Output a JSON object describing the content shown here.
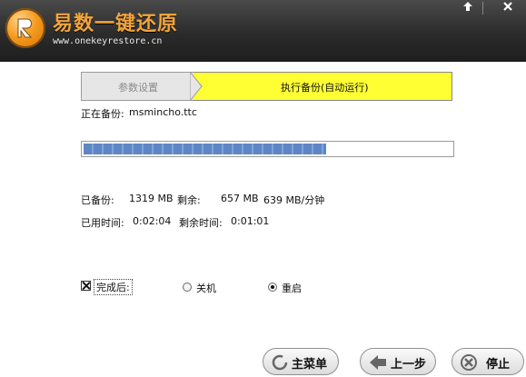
{
  "app": {
    "title": "易数一键还原",
    "url": "www.onekeyrestore.cn",
    "logo_icon": "logo-r-badge"
  },
  "window_controls": {
    "minimize_icon": "minimize-arrow-icon",
    "close_icon": "close-icon"
  },
  "steps": [
    {
      "label": "参数设置",
      "active": false
    },
    {
      "label": "执行备份(自动运行)",
      "active": true
    }
  ],
  "backup": {
    "label": "正在备份:",
    "file": "msmincho.ttc"
  },
  "progress": {
    "fraction": 0.66,
    "color": "#5f86c4"
  },
  "stats": {
    "backed_label": "已备份:",
    "backed_value": "1319 MB",
    "remaining_label": "剩余:",
    "remaining_value": "657 MB",
    "speed_value": "639 MB/分钟",
    "elapsed_label": "已用时间:",
    "elapsed_value": "0:02:04",
    "left_label": "剩余时间:",
    "left_value": "0:01:01"
  },
  "options": {
    "after_label": "完成后:",
    "after_checked": true,
    "choices": [
      {
        "label": "关机",
        "selected": false
      },
      {
        "label": "重启",
        "selected": true
      }
    ]
  },
  "buttons": {
    "main_menu": "主菜单",
    "prev_step": "上一步",
    "stop": "停止"
  },
  "colors": {
    "active_step": "#ffff33",
    "title_orange": "#f2a43a"
  }
}
